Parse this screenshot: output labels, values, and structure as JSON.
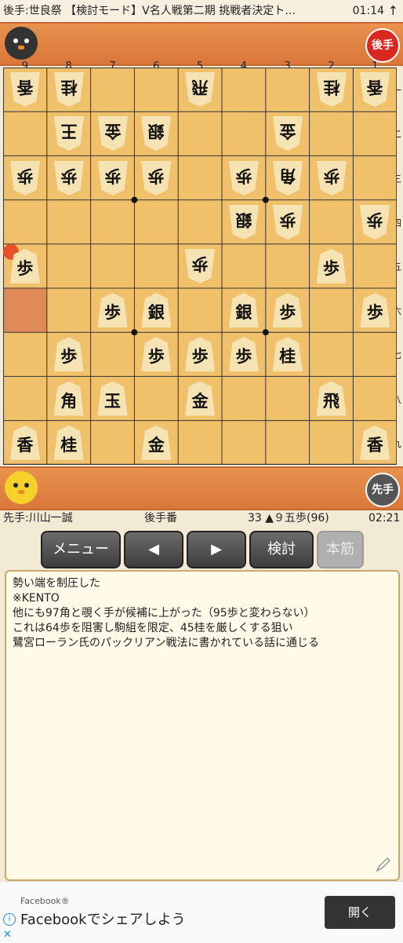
{
  "status": {
    "title": "後手:世良祭 【検討モード】V名人戦第二期 挑戦者決定ト…",
    "time": "01:14",
    "arrow": "↑"
  },
  "top_player": {
    "badge": "後手",
    "badge_color": "#d9281f"
  },
  "bottom_player": {
    "badge": "先手",
    "badge_color": "#555555"
  },
  "board": {
    "col_labels": [
      "9",
      "8",
      "7",
      "6",
      "5",
      "4",
      "3",
      "2",
      "1"
    ],
    "row_labels": [
      "一",
      "二",
      "三",
      "四",
      "五",
      "六",
      "七",
      "八",
      "九"
    ],
    "highlight_color": "#e08a5a",
    "last_move_marker": "#e8502a",
    "pieces": [
      {
        "c": "香",
        "o": "g",
        "col": 9,
        "row": 1
      },
      {
        "c": "桂",
        "o": "g",
        "col": 8,
        "row": 1
      },
      {
        "c": "飛",
        "o": "g",
        "col": 5,
        "row": 1
      },
      {
        "c": "桂",
        "o": "g",
        "col": 2,
        "row": 1
      },
      {
        "c": "香",
        "o": "g",
        "col": 1,
        "row": 1
      },
      {
        "c": "王",
        "o": "g",
        "col": 8,
        "row": 2
      },
      {
        "c": "金",
        "o": "g",
        "col": 7,
        "row": 2
      },
      {
        "c": "銀",
        "o": "g",
        "col": 6,
        "row": 2
      },
      {
        "c": "金",
        "o": "g",
        "col": 3,
        "row": 2
      },
      {
        "c": "歩",
        "o": "g",
        "col": 9,
        "row": 3
      },
      {
        "c": "歩",
        "o": "g",
        "col": 8,
        "row": 3
      },
      {
        "c": "歩",
        "o": "g",
        "col": 7,
        "row": 3
      },
      {
        "c": "歩",
        "o": "g",
        "col": 6,
        "row": 3
      },
      {
        "c": "歩",
        "o": "g",
        "col": 4,
        "row": 3
      },
      {
        "c": "角",
        "o": "g",
        "col": 3,
        "row": 3
      },
      {
        "c": "歩",
        "o": "g",
        "col": 2,
        "row": 3
      },
      {
        "c": "銀",
        "o": "g",
        "col": 4,
        "row": 4
      },
      {
        "c": "歩",
        "o": "g",
        "col": 3,
        "row": 4
      },
      {
        "c": "歩",
        "o": "g",
        "col": 1,
        "row": 4
      },
      {
        "c": "歩",
        "o": "s",
        "col": 9,
        "row": 5
      },
      {
        "c": "歩",
        "o": "g",
        "col": 5,
        "row": 5
      },
      {
        "c": "歩",
        "o": "s",
        "col": 2,
        "row": 5
      },
      {
        "c": "歩",
        "o": "s",
        "col": 7,
        "row": 6
      },
      {
        "c": "銀",
        "o": "s",
        "col": 6,
        "row": 6
      },
      {
        "c": "銀",
        "o": "s",
        "col": 4,
        "row": 6
      },
      {
        "c": "歩",
        "o": "s",
        "col": 3,
        "row": 6
      },
      {
        "c": "歩",
        "o": "s",
        "col": 1,
        "row": 6
      },
      {
        "c": "歩",
        "o": "s",
        "col": 8,
        "row": 7
      },
      {
        "c": "歩",
        "o": "s",
        "col": 6,
        "row": 7
      },
      {
        "c": "歩",
        "o": "s",
        "col": 5,
        "row": 7
      },
      {
        "c": "歩",
        "o": "s",
        "col": 4,
        "row": 7
      },
      {
        "c": "桂",
        "o": "s",
        "col": 3,
        "row": 7
      },
      {
        "c": "角",
        "o": "s",
        "col": 8,
        "row": 8
      },
      {
        "c": "玉",
        "o": "s",
        "col": 7,
        "row": 8
      },
      {
        "c": "金",
        "o": "s",
        "col": 5,
        "row": 8
      },
      {
        "c": "飛",
        "o": "s",
        "col": 2,
        "row": 8
      },
      {
        "c": "香",
        "o": "s",
        "col": 9,
        "row": 9
      },
      {
        "c": "桂",
        "o": "s",
        "col": 8,
        "row": 9
      },
      {
        "c": "金",
        "o": "s",
        "col": 6,
        "row": 9
      },
      {
        "c": "香",
        "o": "s",
        "col": 1,
        "row": 9
      }
    ]
  },
  "info": {
    "sente": "先手:川山一誠",
    "turn": "後手番",
    "move": "33 ▲９五歩(96)",
    "clock": "02:21"
  },
  "buttons": {
    "menu": "メニュー",
    "back": "◀",
    "forward": "▶",
    "analyze": "検討",
    "mainline": "本筋"
  },
  "comment": {
    "lines": [
      "勢い端を制圧した",
      "※KENTO",
      "他にも97角と覗く手が候補に上がった（95歩と変わらない）",
      "これは64歩を阻害し駒組を限定、45桂を厳しくする狙い",
      "鷺宮ローラン氏のパックリアン戦法に書かれている話に通じる"
    ]
  },
  "ad": {
    "brand": "Facebook®",
    "text": "Facebookでシェアしよう",
    "button": "開く"
  }
}
